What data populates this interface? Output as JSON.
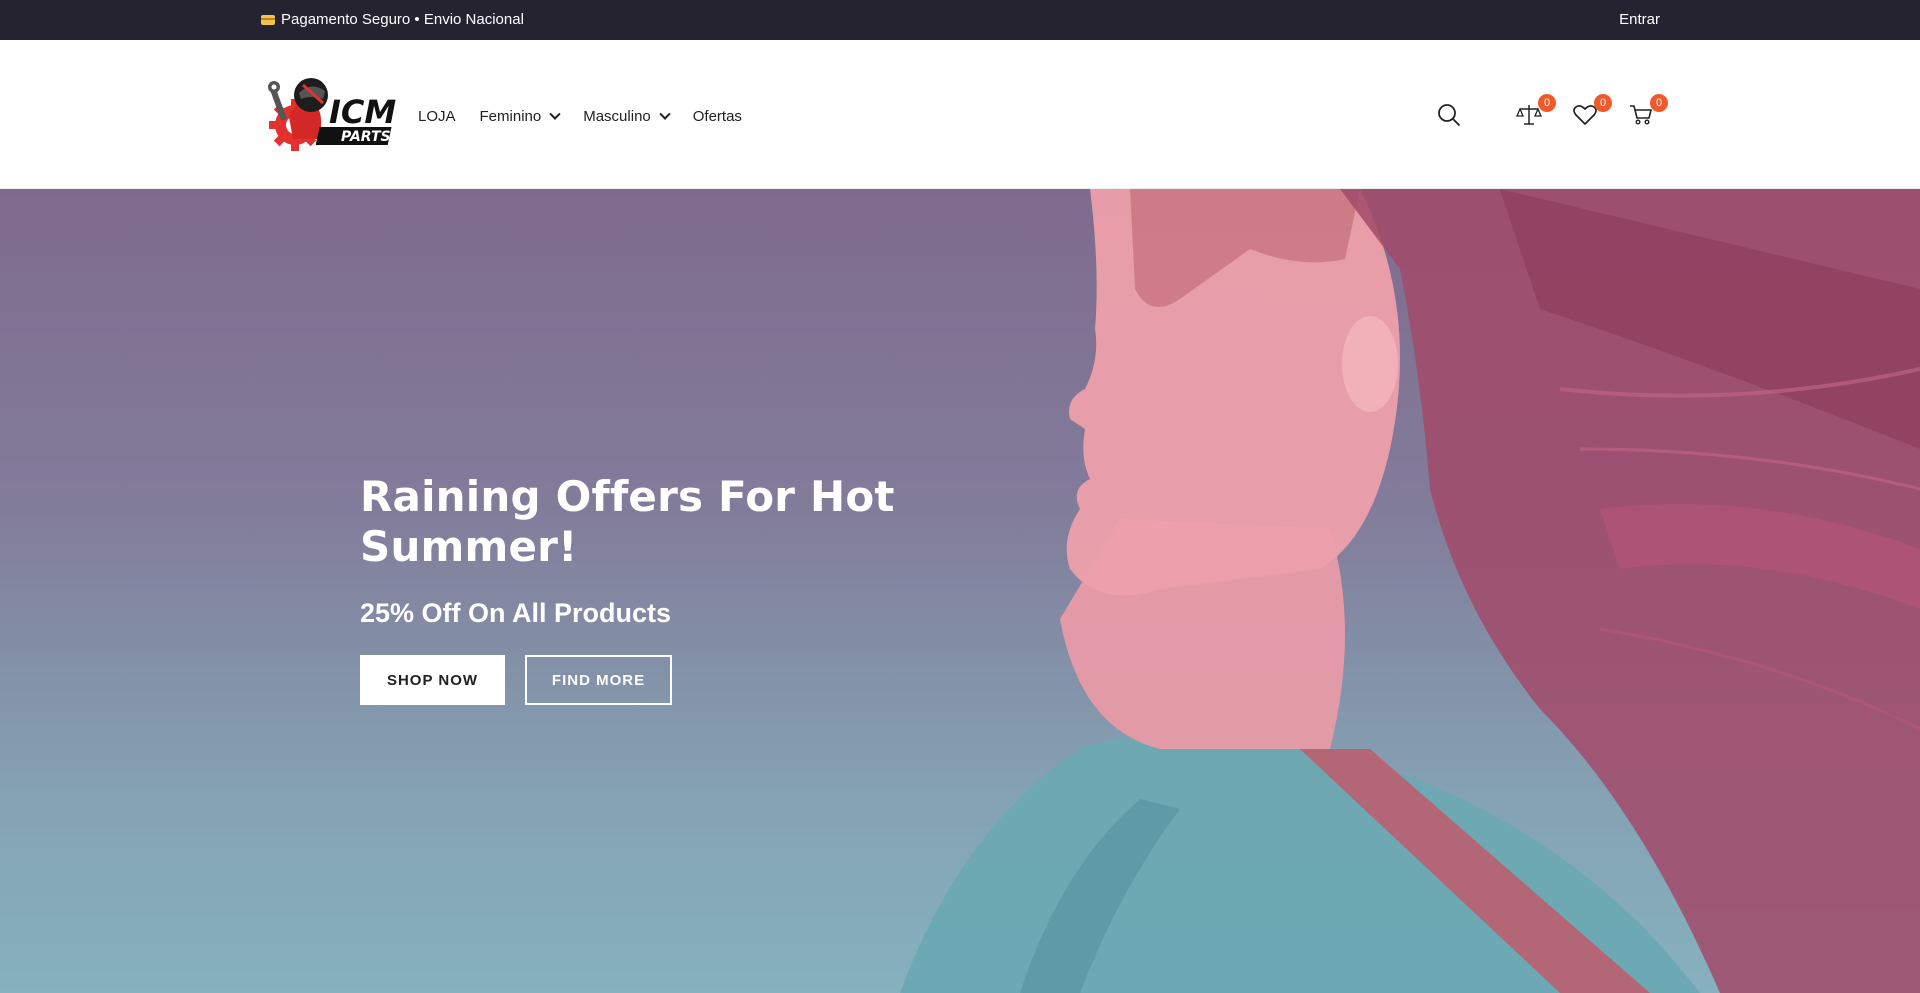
{
  "topbar": {
    "promo_text": "Pagamento Seguro • Envio Nacional",
    "login_label": "Entrar"
  },
  "header": {
    "logo_text": "ICM",
    "logo_subtext": "PARTS",
    "nav": [
      {
        "label": "LOJA",
        "has_dropdown": false
      },
      {
        "label": "Feminino",
        "has_dropdown": true
      },
      {
        "label": "Masculino",
        "has_dropdown": true
      },
      {
        "label": "Ofertas",
        "has_dropdown": false
      }
    ],
    "compare_count": "0",
    "wishlist_count": "0",
    "cart_count": "0"
  },
  "hero": {
    "title": "Raining Offers For Hot Summer!",
    "subtitle": "25% Off On All Products",
    "primary_button": "SHOP NOW",
    "secondary_button": "FIND MORE"
  },
  "colors": {
    "topbar_bg": "#25232f",
    "badge": "#f1592a",
    "hero_top": "#7f6b8e",
    "hero_bottom": "#86b1bf"
  }
}
